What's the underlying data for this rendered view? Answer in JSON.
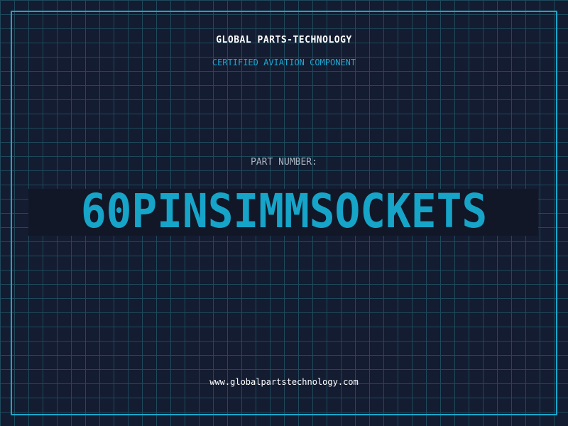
{
  "header": {
    "brand": "GLOBAL PARTS-TECHNOLOGY",
    "subtitle": "CERTIFIED AVIATION COMPONENT"
  },
  "part": {
    "label": "PART NUMBER:",
    "number": "60PINSIMMSOCKETS"
  },
  "footer": {
    "website": "www.globalpartstechnology.com"
  },
  "colors": {
    "background": "#131c31",
    "grid": "#1f4a5c",
    "frame": "#1aa6cc",
    "accent": "#16a4c9",
    "text_primary": "#ffffff",
    "text_muted": "#a9b3bf"
  }
}
